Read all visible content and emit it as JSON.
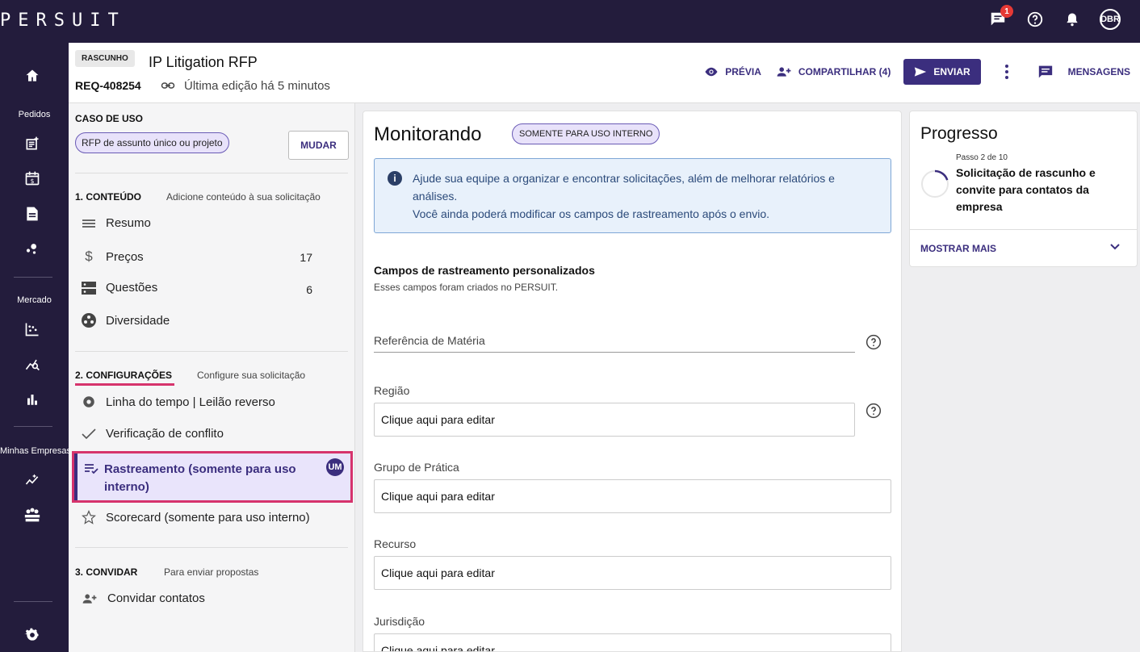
{
  "topbar": {
    "logo": "PERSUIT",
    "messages_badge": "1",
    "user_initials": "DBR"
  },
  "left_nav": {
    "section_orders": "Pedidos",
    "section_market": "Mercado",
    "section_companies": "Minhas Empresas"
  },
  "header": {
    "status_tag": "RASCUNHO",
    "title": "IP Litigation RFP",
    "request_id": "REQ-408254",
    "last_edit": "Última edição há 5 minutos",
    "preview_label": "PRÉVIA",
    "share_label": "COMPARTILHAR (4)",
    "send_label": "ENVIAR",
    "messages_label": "MENSAGENS"
  },
  "use_case": {
    "title": "CASO DE USO",
    "chip": "RFP de assunto único ou projeto",
    "change_label": "MUDAR"
  },
  "content_section": {
    "title": "1. CONTEÚDO",
    "subtitle": "Adicione conteúdo à sua solicitação",
    "items": [
      {
        "label": "Resumo",
        "count": ""
      },
      {
        "label": "Preços",
        "count": "17"
      },
      {
        "label": "Questões",
        "count": "6"
      },
      {
        "label": "Diversidade",
        "count": ""
      }
    ]
  },
  "config_section": {
    "title": "2. CONFIGURAÇÕES",
    "subtitle": "Configure sua solicitação",
    "items": [
      {
        "label": "Linha do tempo | Leilão reverso"
      },
      {
        "label": "Verificação de conflito"
      },
      {
        "label": "Rastreamento (somente para uso interno)",
        "avatar": "UM"
      },
      {
        "label": "Scorecard (somente para uso interno)"
      }
    ]
  },
  "invite_section": {
    "title": "3. CONVIDAR",
    "subtitle": "Para enviar propostas",
    "item": "Convidar contatos"
  },
  "main": {
    "title": "Monitorando",
    "internal_chip": "SOMENTE PARA USO INTERNO",
    "info_line1": "Ajude sua equipe a organizar e encontrar solicitações, além de melhorar relatórios e análises.",
    "info_line2": "Você ainda poderá modificar os campos de rastreamento após o envio.",
    "custom_fields_title": "Campos de rastreamento personalizados",
    "custom_fields_sub": "Esses campos foram criados no PERSUIT.",
    "fields": [
      {
        "label": "Referência de Matéria",
        "value": ""
      },
      {
        "label": "Região",
        "value": "Clique aqui para editar"
      },
      {
        "label": "Grupo de Prática",
        "value": "Clique aqui para editar"
      },
      {
        "label": "Recurso",
        "value": "Clique aqui para editar"
      },
      {
        "label": "Jurisdição",
        "value": "Clique aqui para editar"
      }
    ]
  },
  "progress": {
    "title": "Progresso",
    "step": "Passo 2 de 10",
    "description": "Solicitação de rascunho e convite para contatos da empresa",
    "show_more": "MOSTRAR MAIS",
    "fraction": 0.2
  },
  "colors": {
    "nav_bg": "#231c3c",
    "accent": "#3b2e7e",
    "highlight": "#d6336c",
    "chip_bg": "#e8e2fa",
    "info_bg": "#e8f1fb"
  }
}
